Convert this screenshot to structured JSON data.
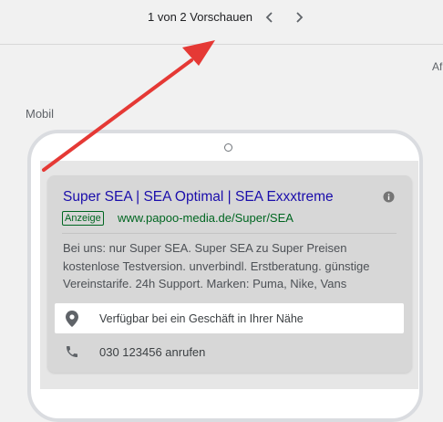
{
  "header": {
    "preview_counter": "1 von 2 Vorschauen",
    "prev_icon": "chevron-left-icon",
    "next_icon": "chevron-right-icon"
  },
  "clipped_label": "Af",
  "section_label": "Mobil",
  "ad": {
    "title": "Super SEA | SEA Optimal | SEA Exxxtreme",
    "badge": "Anzeige",
    "display_url": "www.papoo-media.de/Super/SEA",
    "description": "Bei uns: nur Super SEA. Super SEA zu Super Preisen kostenlose Testversion. unverbindl. Erstberatung. günstige Vereinstarife. 24h Support. Marken: Puma, Nike, Vans",
    "info_icon": "info-icon",
    "location_extension": {
      "icon": "location-pin-icon",
      "text": "Verfügbar bei ein Geschäft in Ihrer Nähe"
    },
    "call_extension": {
      "icon": "phone-icon",
      "text": "030 123456 anrufen"
    }
  },
  "colors": {
    "ad_title": "#1a0dab",
    "ad_url": "#006621",
    "annotation_arrow": "#e53935"
  }
}
